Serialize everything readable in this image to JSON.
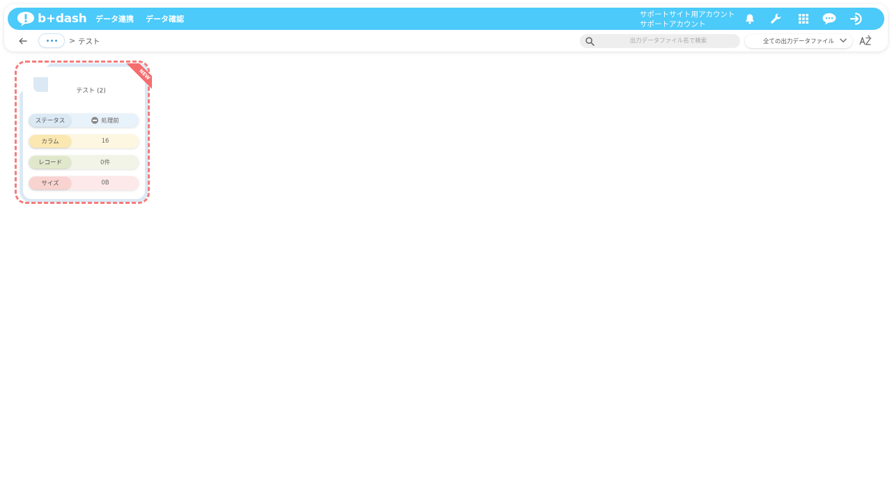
{
  "app": {
    "logo_text": "b+dash"
  },
  "nav": [
    {
      "label": "データ連携"
    },
    {
      "label": "データ確認"
    }
  ],
  "account": {
    "line1": "サポートサイト用アカウント",
    "line2": "サポートアカウント"
  },
  "icons": {
    "notifications": "bell-icon",
    "settings": "wrench-icon",
    "apps": "grid-icon",
    "help": "chat-bubble-icon",
    "logout": "logout-icon"
  },
  "breadcrumb": {
    "current": "テスト",
    "separator": ">"
  },
  "search": {
    "placeholder": "出力データファイル名で検索",
    "value": ""
  },
  "filter": {
    "selected": "全ての出力データファイル"
  },
  "sort": {
    "label": "AZ"
  },
  "colors": {
    "brand": "#4ccafa",
    "outline": "#f77a7a",
    "status_bg": "#e8f2fa",
    "column_bg": "#fdf7e1",
    "record_bg": "#f1f4e6",
    "size_bg": "#fde9e9",
    "status_label": "#dbe9f5",
    "column_label": "#fbe8b0",
    "record_label": "#e0e8cc",
    "size_label": "#f9d3d0"
  },
  "file_card": {
    "badge": "NEW",
    "title": "テスト (2)",
    "rows": [
      {
        "label": "ステータス",
        "value": "処理前"
      },
      {
        "label": "カラム",
        "value": "16"
      },
      {
        "label": "レコード",
        "value": "0件"
      },
      {
        "label": "サイズ",
        "value": "0B"
      }
    ]
  }
}
